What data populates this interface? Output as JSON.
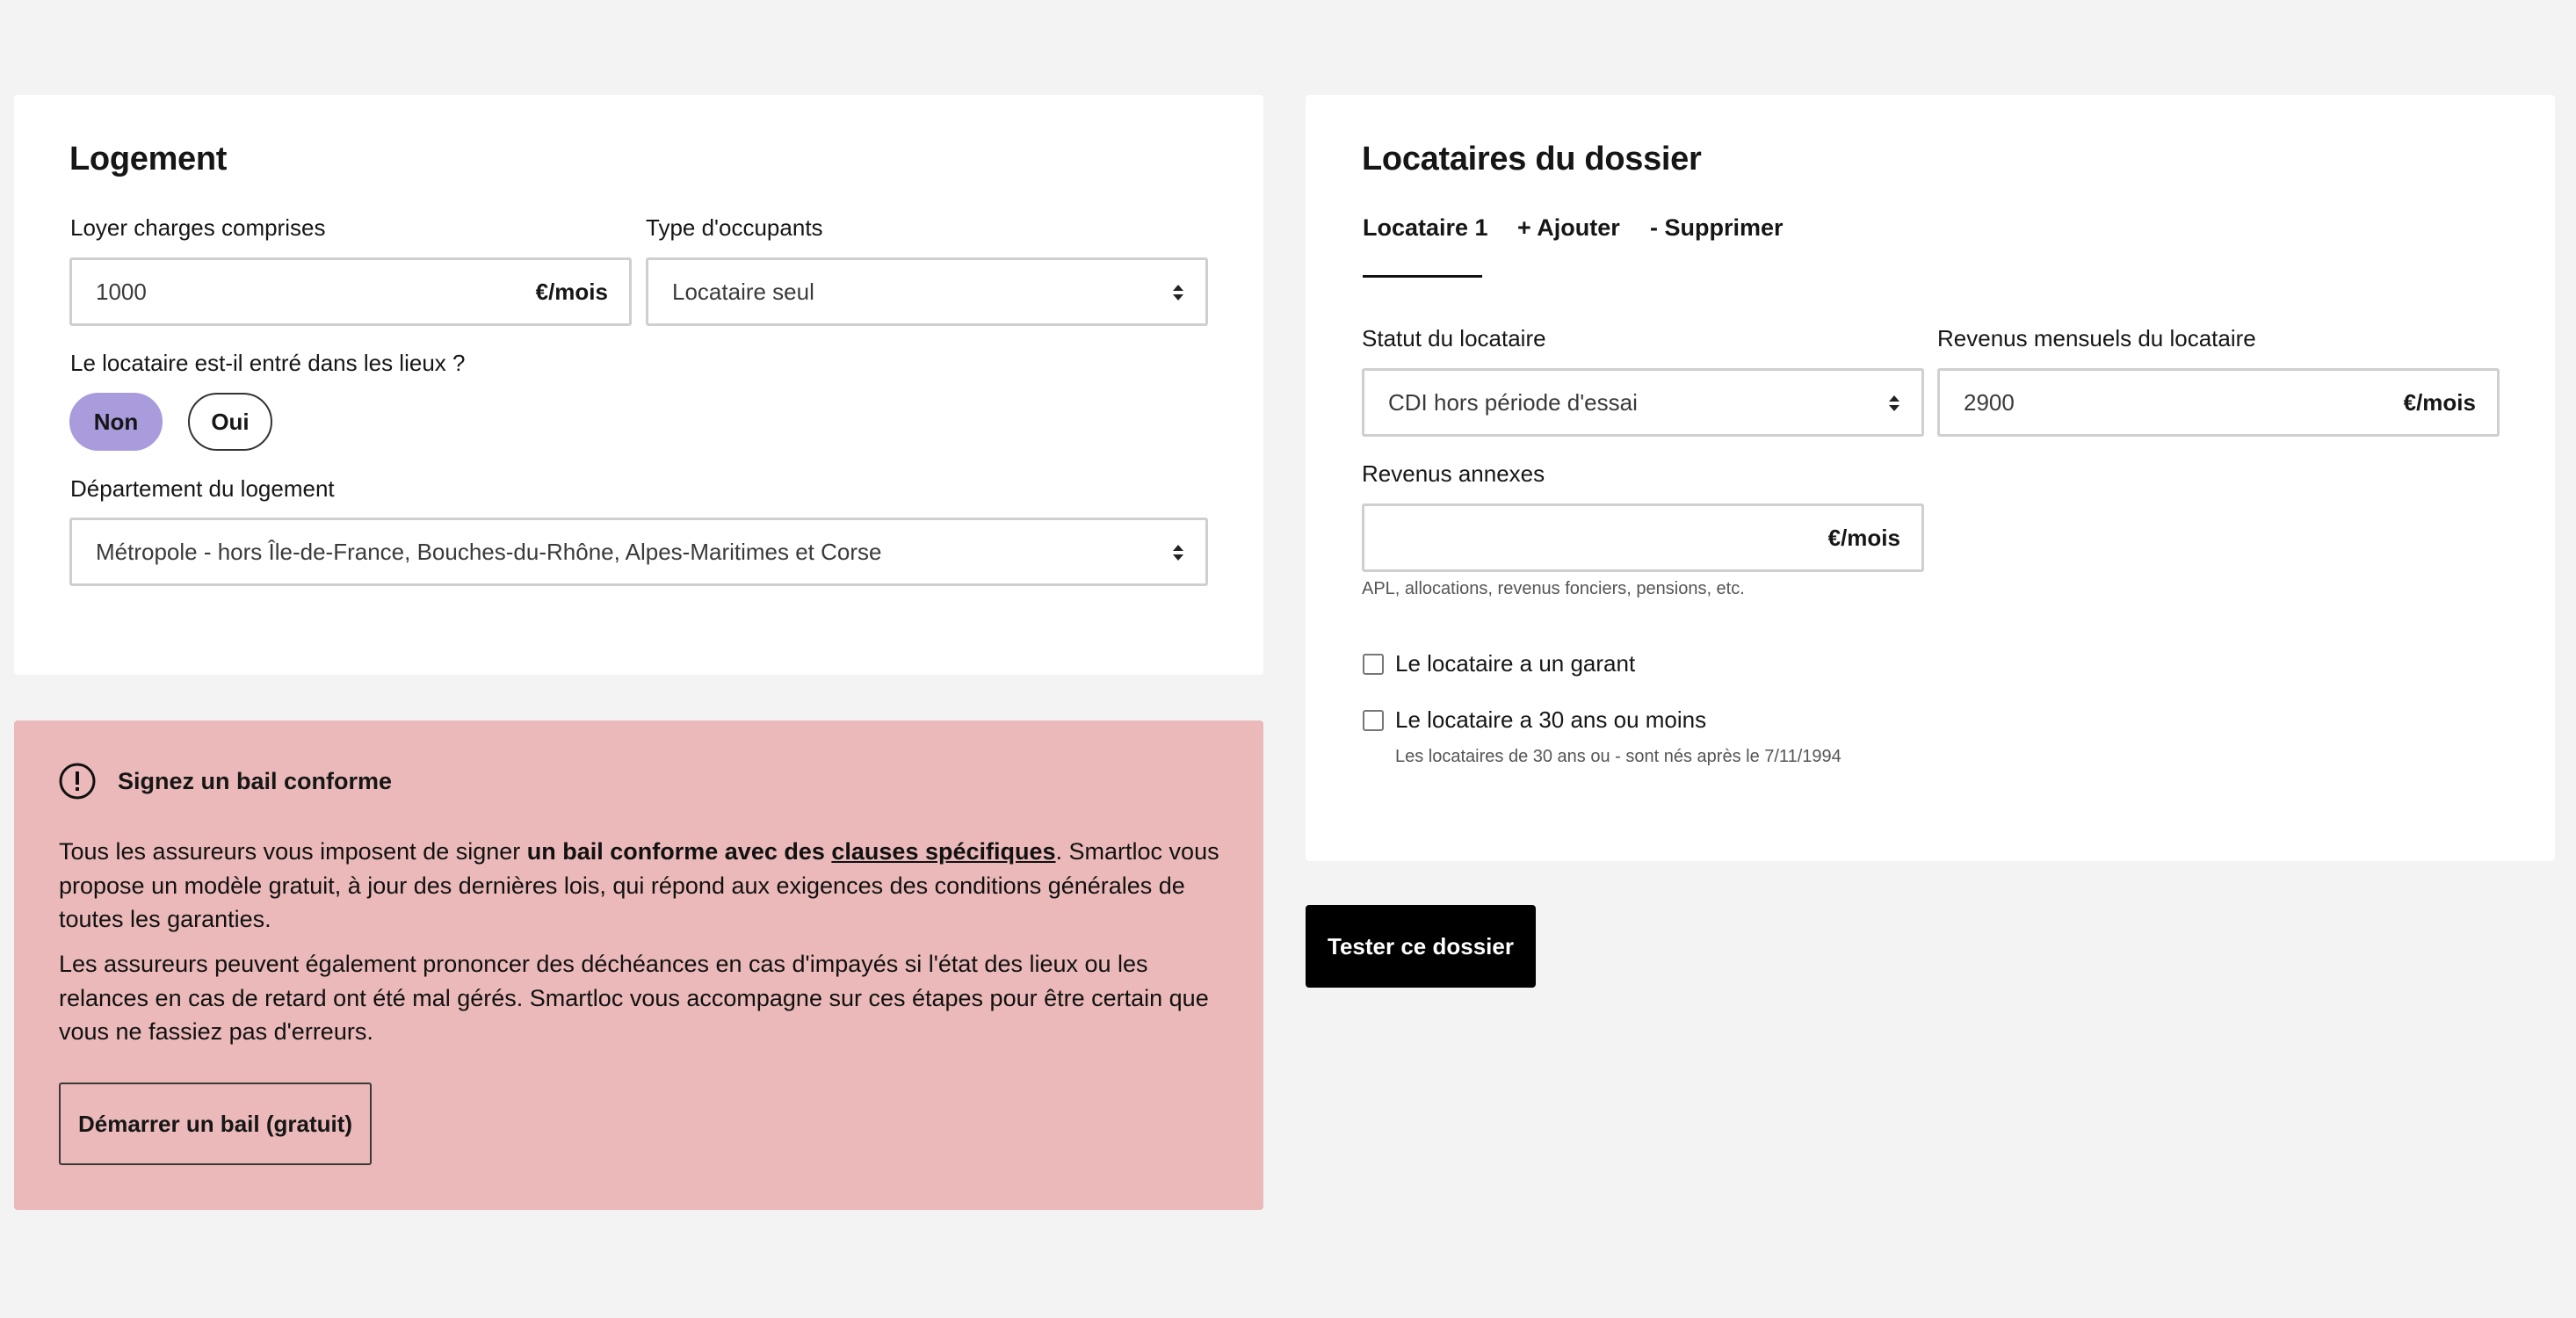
{
  "logement": {
    "title": "Logement",
    "loyer_label": "Loyer charges comprises",
    "loyer_value": "1000",
    "loyer_unit": "€/mois",
    "type_occupants_label": "Type d'occupants",
    "type_occupants_value": "Locataire seul",
    "entre_question": "Le locataire est-il entré dans les lieux ?",
    "entre_options": [
      "Non",
      "Oui"
    ],
    "entre_selected": "Non",
    "departement_label": "Département du logement",
    "departement_value": "Métropole - hors Île-de-France, Bouches-du-Rhône, Alpes-Maritimes et Corse"
  },
  "alert": {
    "title": "Signez un bail conforme",
    "p1_before": "Tous les assureurs vous imposent de signer ",
    "p1_bold": "un bail conforme avec des ",
    "p1_link": "clauses spécifiques",
    "p1_after": ". Smartloc vous propose un modèle gratuit, à jour des dernières lois, qui répond aux exigences des conditions générales de toutes les garanties.",
    "p2": "Les assureurs peuvent également prononcer des déchéances en cas d'impayés si l'état des lieux ou les relances en cas de retard ont été mal gérés. Smartloc vous accompagne sur ces étapes pour être certain que vous ne fassiez pas d'erreurs.",
    "button": "Démarrer un bail (gratuit)",
    "background": "#ebb9b9"
  },
  "locataires": {
    "title": "Locataires du dossier",
    "tabs": [
      "Locataire 1",
      "+ Ajouter",
      "- Supprimer"
    ],
    "active_tab": "Locataire 1",
    "statut_label": "Statut du locataire",
    "statut_value": "CDI hors période d'essai",
    "revenus_label": "Revenus mensuels du locataire",
    "revenus_value": "2900",
    "revenus_unit": "€/mois",
    "annexes_label": "Revenus annexes",
    "annexes_value": "",
    "annexes_unit": "€/mois",
    "annexes_hint": "APL, allocations, revenus fonciers, pensions, etc.",
    "garant_label": "Le locataire a un garant",
    "garant_checked": false,
    "age_label": "Le locataire a 30 ans ou moins",
    "age_checked": false,
    "age_hint": "Les locataires de 30 ans ou - sont nés après le 7/11/1994"
  },
  "submit_button": "Tester ce dossier",
  "colors": {
    "accent_pill": "#a99bdc",
    "page_bg": "#f3f3f3"
  }
}
